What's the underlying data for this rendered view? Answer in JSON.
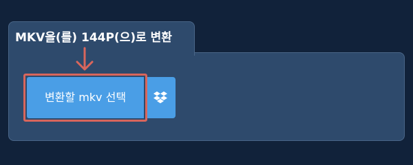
{
  "panel": {
    "title": "MKV을(를) 144P(으)로 변환"
  },
  "uploader": {
    "select_label": "변환할 mkv 선택",
    "dropbox_icon": "dropbox-icon",
    "dropbox_aria": "Dropbox"
  },
  "colors": {
    "page_background": "#11223a",
    "panel_background": "#2e4a6c",
    "button_blue": "#4a9ee6",
    "highlight_red": "#d9665c"
  }
}
